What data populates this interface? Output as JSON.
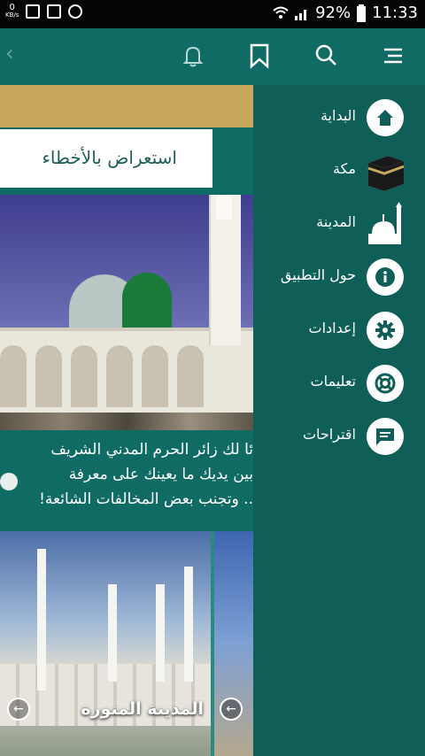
{
  "status_bar": {
    "kbs_value": "0",
    "kbs_unit": "KB/s",
    "battery": "92%",
    "time": "11:33"
  },
  "toolbar": {
    "icons": [
      "back-chevron-icon",
      "bell-icon",
      "bookmark-icon",
      "search-icon",
      "menu-icon"
    ]
  },
  "content": {
    "review_errors_button": "استعراض بالأخطاء",
    "description_lines": [
      "ئا لك زائر الحرم المدني الشريف",
      "بين يديك ما يعينك على معرفة",
      ".. وتجنب بعض المخالفات الشائعة!"
    ],
    "cards": [
      {
        "label": "المدينة المنورة"
      }
    ]
  },
  "drawer": {
    "items": [
      {
        "label": "البداية",
        "icon": "home-icon"
      },
      {
        "label": "مكة",
        "icon": "kaaba-icon"
      },
      {
        "label": "المدينة",
        "icon": "mosque-icon"
      },
      {
        "label": "حول التطبيق",
        "icon": "info-icon"
      },
      {
        "label": "إعدادات",
        "icon": "gear-icon"
      },
      {
        "label": "تعليمات",
        "icon": "lifebuoy-icon"
      },
      {
        "label": "اقتراحات",
        "icon": "chat-icon"
      }
    ]
  },
  "colors": {
    "primary": "#0f6b64",
    "drawer": "#0f5f58",
    "accent_gold": "#c8a75e"
  }
}
